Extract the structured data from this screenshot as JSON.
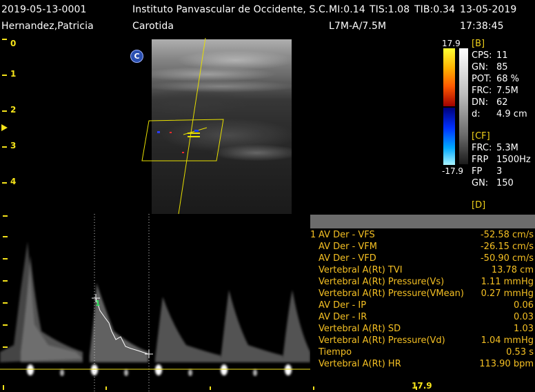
{
  "header": {
    "exam_id": "2019-05-13-0001",
    "institution": "Instituto Panvascular de Occidente, S.C.",
    "mi": "MI:0.14",
    "tis": "TIS:1.08",
    "tib": "TIB:0.34",
    "date": "13-05-2019",
    "patient": "Hernandez,Patricia",
    "exam_type": "Carotida",
    "probe": "L7M-A/7.5M",
    "time": "17:38:45"
  },
  "depth_scale": [
    "0",
    "1",
    "2",
    "3",
    "4"
  ],
  "image_badge": "C",
  "colorbar": {
    "max": "17.9",
    "min": "-17.9"
  },
  "params": {
    "b_section": "[B]",
    "b": [
      {
        "k": "CPS:",
        "v": "11"
      },
      {
        "k": "GN:",
        "v": "85"
      },
      {
        "k": "POT:",
        "v": "68 %"
      },
      {
        "k": "FRC:",
        "v": "7.5M"
      },
      {
        "k": "DN:",
        "v": "62"
      },
      {
        "k": "d:",
        "v": "4.9 cm"
      }
    ],
    "cf_section": "[CF]",
    "cf": [
      {
        "k": "FRC:",
        "v": "5.3M"
      },
      {
        "k": "FRP",
        "v": "1500Hz"
      },
      {
        "k": "FP",
        "v": "3"
      },
      {
        "k": "GN:",
        "v": "150"
      }
    ],
    "d_section": "[D]"
  },
  "measurements": {
    "index": "1",
    "rows": [
      {
        "label": "AV Der - VFS",
        "value": "-52.58 cm/s"
      },
      {
        "label": "AV Der - VFM",
        "value": "-26.15 cm/s"
      },
      {
        "label": "AV Der - VFD",
        "value": "-50.90 cm/s"
      },
      {
        "label": "Vertebral A(Rt) TVI",
        "value": "13.78 cm"
      },
      {
        "label": "Vertebral A(Rt) Pressure(Vs)",
        "value": "1.11 mmHg"
      },
      {
        "label": "Vertebral A(Rt) Pressure(VMean)",
        "value": "0.27 mmHg"
      },
      {
        "label": "AV Der - IP",
        "value": "0.06"
      },
      {
        "label": "AV Der - IR",
        "value": "0.03"
      },
      {
        "label": "Vertebral A(Rt) SD",
        "value": "1.03"
      },
      {
        "label": "Vertebral A(Rt) Pressure(Vd)",
        "value": "1.04 mmHg"
      },
      {
        "label": "Tiempo",
        "value": "0.53 s"
      },
      {
        "label": "Vertebral A(Rt) HR",
        "value": "113.90 bpm"
      }
    ]
  },
  "doppler": {
    "cursor_label": "1",
    "baseline_value": "17.9"
  },
  "colors": {
    "ruler": "#f5e31a",
    "measure_text": "#f5c023",
    "sample_box": "#e8e000",
    "cursor_mark": "#2ee05a"
  }
}
